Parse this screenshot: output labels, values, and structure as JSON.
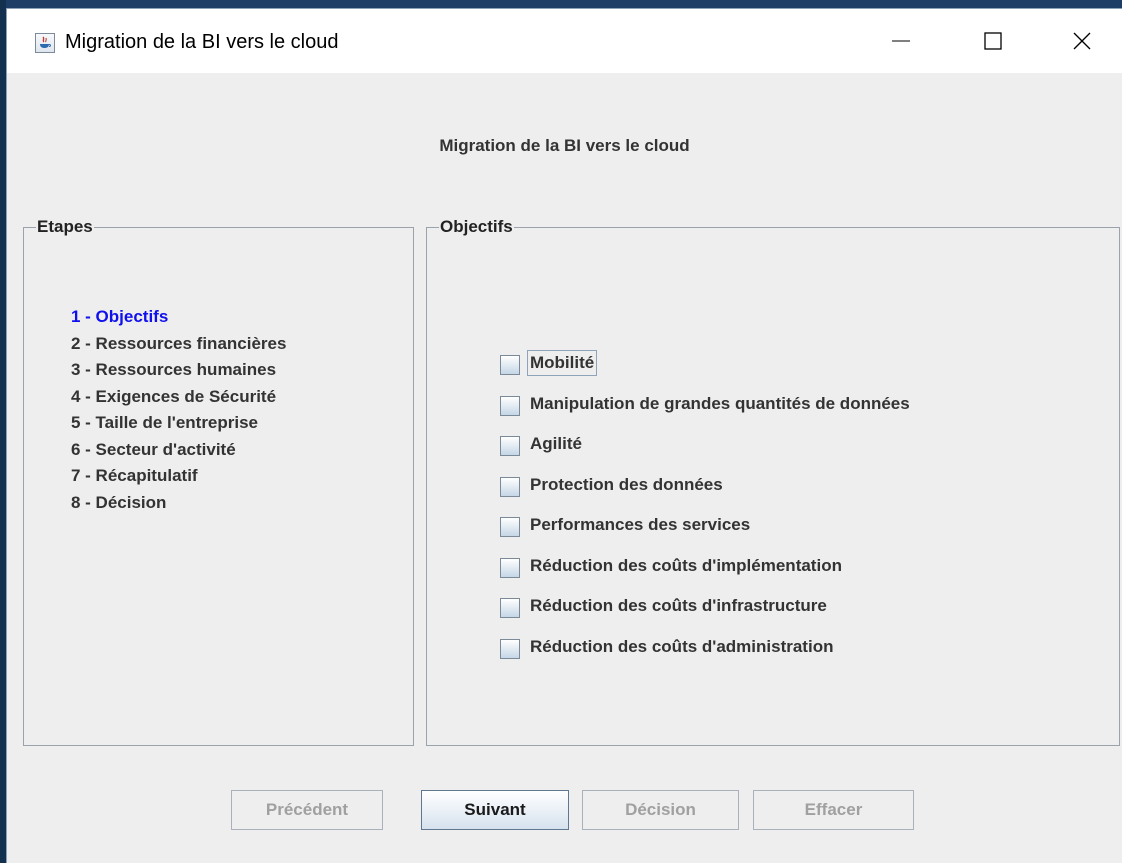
{
  "window": {
    "title": "Migration de la BI vers le cloud",
    "icon": "java-app-icon",
    "controls": [
      "minimize-icon",
      "maximize-icon",
      "close-icon"
    ]
  },
  "header": {
    "title": "Migration de la BI vers le cloud"
  },
  "steps_panel": {
    "title": "Etapes",
    "items": [
      {
        "label": "1 - Objectifs",
        "active": true
      },
      {
        "label": "2 - Ressources financières"
      },
      {
        "label": "3 - Ressources humaines"
      },
      {
        "label": "4 - Exigences de Sécurité"
      },
      {
        "label": "5 - Taille de l'entreprise"
      },
      {
        "label": "6 - Secteur d'activité"
      },
      {
        "label": "7 - Récapitulatif"
      },
      {
        "label": "8 - Décision"
      }
    ]
  },
  "objectives_panel": {
    "title": "Objectifs",
    "options": [
      {
        "label": "Mobilité",
        "checked": false
      },
      {
        "label": "Manipulation de grandes quantités de données",
        "checked": false
      },
      {
        "label": "Agilité",
        "checked": false
      },
      {
        "label": "Protection des données",
        "checked": false
      },
      {
        "label": "Performances des services",
        "checked": false
      },
      {
        "label": "Réduction des coûts d'implémentation",
        "checked": false
      },
      {
        "label": "Réduction des coûts d'infrastructure",
        "checked": false
      },
      {
        "label": "Réduction des coûts d'administration",
        "checked": false
      }
    ]
  },
  "buttons": {
    "previous": {
      "label": "Précédent",
      "enabled": false
    },
    "next": {
      "label": "Suivant",
      "enabled": true
    },
    "decision": {
      "label": "Décision",
      "enabled": false
    },
    "clear": {
      "label": "Effacer",
      "enabled": false
    }
  },
  "colors": {
    "active_step": "#1010ee",
    "panel_border": "#9aa3ab",
    "window_bg": "#eeeeee"
  }
}
